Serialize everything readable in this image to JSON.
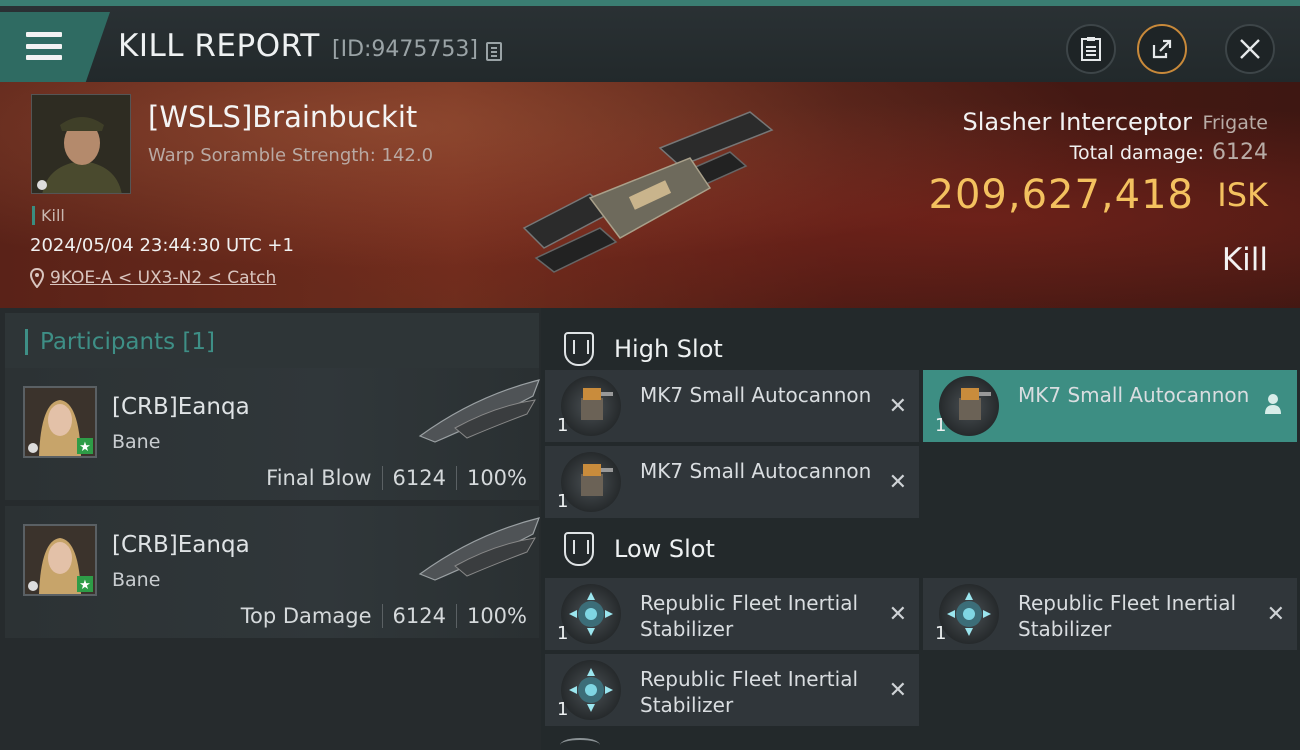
{
  "header": {
    "title": "KILL REPORT",
    "report_id": "[ID:9475753]"
  },
  "victim": {
    "pilot": "[WSLS]Brainbuckit",
    "warp_scramble": "Warp Soramble Strength: 142.0",
    "kill_tag": "Kill",
    "timestamp": "2024/05/04 23:44:30 UTC +1",
    "location": "9KOE-A < UX3-N2 < Catch",
    "ship_name": "Slasher Interceptor",
    "ship_class": "Frigate",
    "total_damage_label": "Total damage:",
    "total_damage": "6124",
    "isk_value": "209,627,418",
    "isk_unit": "ISK",
    "result": "Kill"
  },
  "participants": {
    "title": "Participants [1]",
    "items": [
      {
        "name": "[CRB]Eanqa",
        "ship": "Bane",
        "role": "Final Blow",
        "damage": "6124",
        "percent": "100%"
      },
      {
        "name": "[CRB]Eanqa",
        "ship": "Bane",
        "role": "Top Damage",
        "damage": "6124",
        "percent": "100%"
      }
    ]
  },
  "fitting": {
    "high_slot_label": "High Slot",
    "low_slot_label": "Low Slot",
    "high": [
      {
        "qty": "1",
        "name": "MK7 Small Autocannon",
        "selected": false
      },
      {
        "qty": "1",
        "name": "MK7 Small Autocannon",
        "selected": true
      },
      {
        "qty": "1",
        "name": "MK7 Small Autocannon",
        "selected": false
      }
    ],
    "low": [
      {
        "qty": "1",
        "name": "Republic Fleet Inertial Stabilizer"
      },
      {
        "qty": "1",
        "name": "Republic Fleet Inertial Stabilizer"
      },
      {
        "qty": "1",
        "name": "Republic Fleet Inertial Stabilizer"
      }
    ]
  },
  "colors": {
    "accent": "#3d8e83",
    "isk": "#f3c15f"
  },
  "icons": [
    "menu-icon",
    "copy-icon",
    "clipboard-icon",
    "share-icon",
    "close-icon",
    "location-pin-icon",
    "high-slot-icon",
    "low-slot-icon",
    "remove-x-icon",
    "person-icon"
  ]
}
